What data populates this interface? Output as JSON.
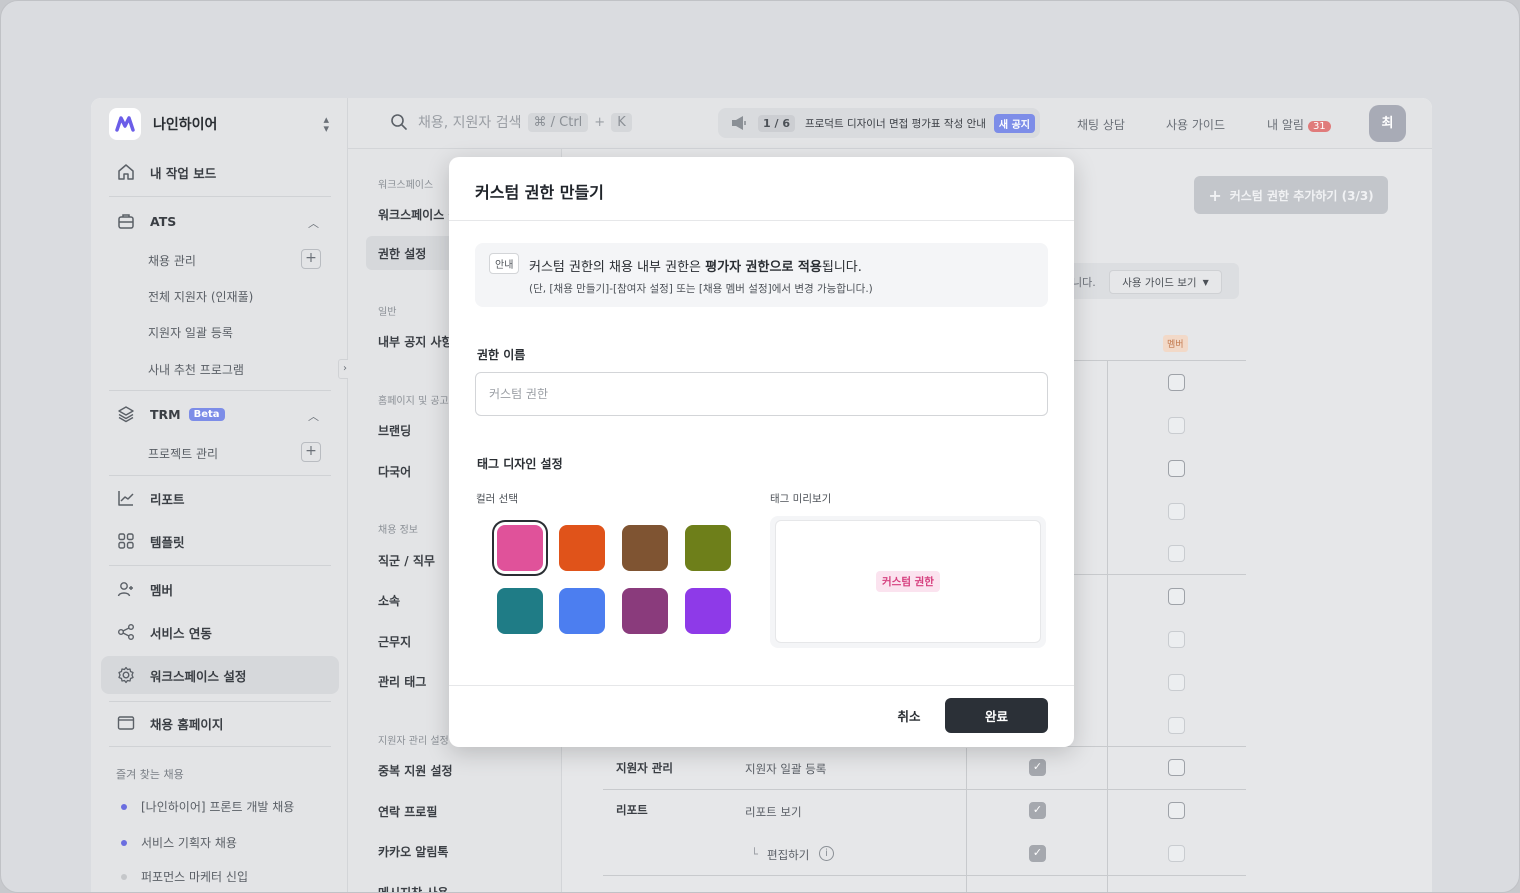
{
  "workspace": {
    "name": "나인하이어"
  },
  "sidebar": {
    "main": [
      {
        "label": "내 작업 보드",
        "icon": "home-icon"
      }
    ],
    "ats": {
      "label": "ATS",
      "items": [
        "채용 관리",
        "전체 지원자 (인재풀)",
        "지원자 일괄 등록",
        "사내 추천 프로그램"
      ]
    },
    "trm": {
      "label": "TRM",
      "badge": "Beta",
      "items": [
        "프로젝트 관리"
      ]
    },
    "more": [
      {
        "label": "리포트"
      },
      {
        "label": "템플릿"
      },
      {
        "label": "멤버"
      },
      {
        "label": "서비스 연동"
      },
      {
        "label": "워크스페이스 설정"
      },
      {
        "label": "채용 홈페이지"
      }
    ],
    "favorites_title": "즐겨 찾는 채용",
    "favorites": [
      {
        "label": "[나인하이어] 프론트 개발 채용",
        "color": "#6b6ee0"
      },
      {
        "label": "서비스 기획자 채용",
        "color": "#6b6ee0"
      },
      {
        "label": "퍼포먼스 마케터 신입",
        "color": "#c5c7ca"
      }
    ]
  },
  "header": {
    "search_placeholder": "채용, 지원자 검색",
    "shortcut": "⌘ / Ctrl",
    "shortcut_plus": "+",
    "shortcut_key": "K",
    "notice_count": "1 / 6",
    "notice_text": "프로덕트 디자이너 면접 평가표 작성 안내",
    "notice_badge": "새 공지",
    "chat": "채팅 상담",
    "guide": "사용 가이드",
    "alarm": "내 알림",
    "alarm_count": "31",
    "avatar": "최"
  },
  "settings": {
    "sections": [
      {
        "title": "워크스페이스",
        "items": [
          "워크스페이스 정",
          "권한 설정"
        ]
      },
      {
        "title": "일반",
        "items": [
          "내부 공지 사항"
        ]
      },
      {
        "title": "홈페이지 및 공고",
        "items": [
          "브랜딩",
          "다국어"
        ]
      },
      {
        "title": "채용 정보",
        "items": [
          "직군 / 직무",
          "소속",
          "근무지",
          "관리 태그"
        ]
      },
      {
        "title": "지원자 관리 설정",
        "items": [
          "중복 지원 설정",
          "연락 프로필",
          "카카오 알림톡",
          "메시지창 사용"
        ]
      }
    ]
  },
  "content": {
    "add_button": "커스텀 권한 추가하기 (3/3)",
    "guide_suffix": "니다.",
    "guide_button": "사용 가이드 보기",
    "member_tag": "멤버",
    "rows": [
      {
        "group": "지원자 관리",
        "item": "지원자 일괄 등록"
      },
      {
        "group": "리포트",
        "item": "리포트 보기"
      },
      {
        "group": "",
        "item": "편집하기"
      }
    ]
  },
  "modal": {
    "title": "커스텀 권한 만들기",
    "info_badge": "안내",
    "info_pre": "커스텀 권한의 채용 내부 권한은 ",
    "info_bold": "평가자 권한으로 적용",
    "info_post": "됩니다.",
    "info_sub": "(단, [채용 만들기]-[참여자 설정] 또는 [채용 멤버 설정]에서 변경 가능합니다.)",
    "name_label": "권한 이름",
    "name_placeholder": "커스텀 권한",
    "design_label": "태그 디자인 설정",
    "color_label": "컬러 선택",
    "preview_label": "태그 미리보기",
    "preview_tag": "커스텀 권한",
    "colors": [
      "#e0529a",
      "#e0531a",
      "#7f5432",
      "#6e7f1a",
      "#1f7c86",
      "#4c7ef0",
      "#8a3b7c",
      "#8e3ae8"
    ],
    "selected_color": "#e0529a",
    "cancel": "취소",
    "confirm": "완료"
  }
}
